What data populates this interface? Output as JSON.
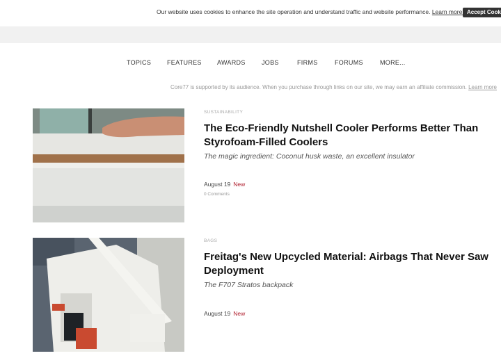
{
  "cookie": {
    "message": "Our website uses cookies to enhance the site operation and understand traffic and website performance.",
    "learn_more": "Learn more.",
    "accept": "Accept Cookie"
  },
  "nav": {
    "items": [
      "TOPICS",
      "FEATURES",
      "AWARDS",
      "JOBS",
      "FIRMS",
      "FORUMS",
      "MORE..."
    ]
  },
  "affiliate": {
    "text": "Core77 is supported by its audience. When you purchase through links on our site, we may earn an affiliate commission.",
    "link": "Learn more"
  },
  "articles": [
    {
      "category": "SUSTAINABILITY",
      "title": "The Eco-Friendly Nutshell Cooler Performs Better Than Styrofoam-Filled Coolers",
      "subtitle": "The magic ingredient: Coconut husk waste, an excellent insulator",
      "date": "August 19",
      "badge": "New",
      "comments": "0 Comments"
    },
    {
      "category": "BAGS",
      "title": "Freitag's New Upcycled Material: Airbags That Never Saw Deployment",
      "subtitle": "The F707 Stratos backpack",
      "date": "August 19",
      "badge": "New"
    }
  ],
  "colors": {
    "accent_new": "#b01f2e",
    "accept_button": "#333333"
  }
}
